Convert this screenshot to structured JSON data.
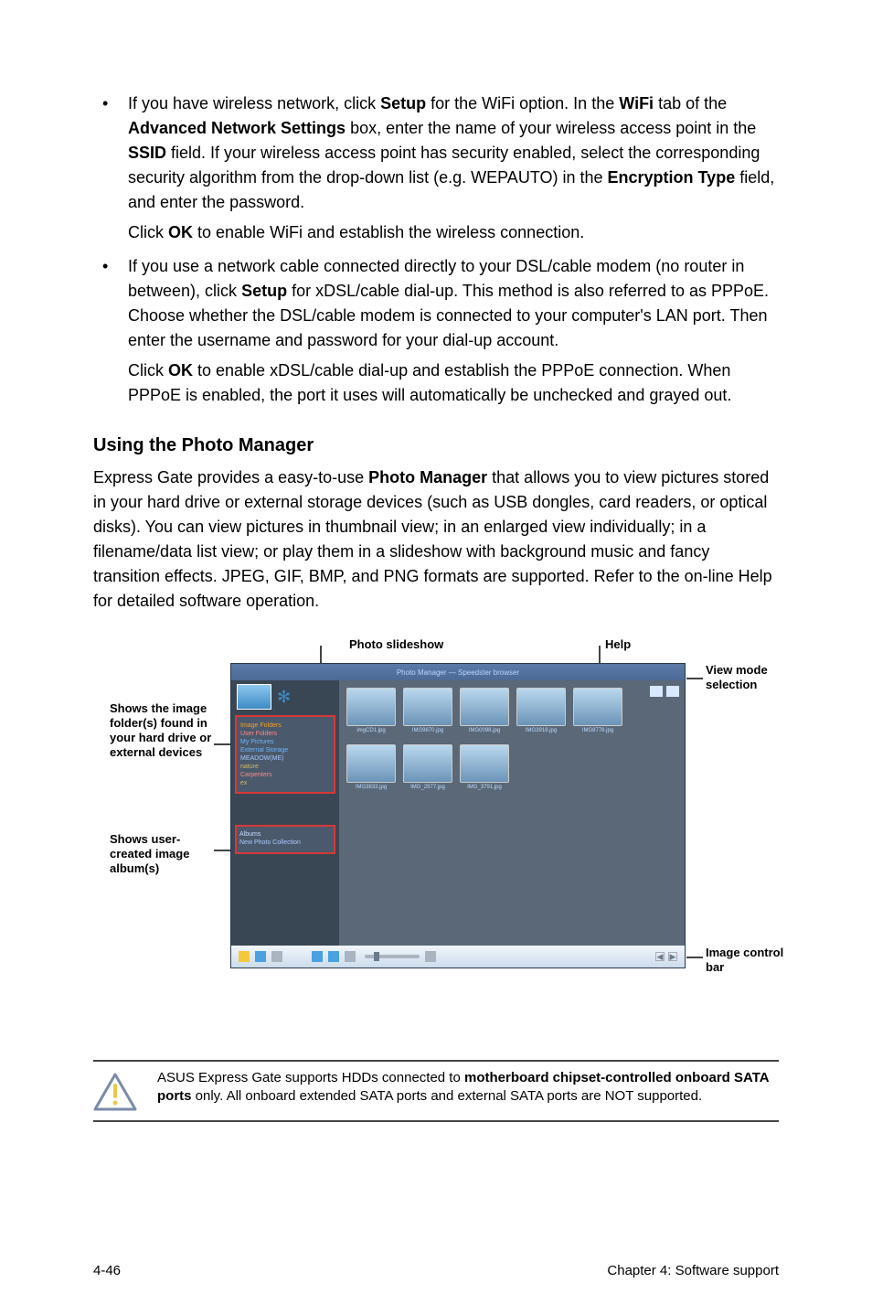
{
  "bullets": {
    "item1": {
      "text": "If you have wireless network, click <b>Setup</b> for the WiFi option. In the <b>WiFi</b> tab of the <b>Advanced Network Settings</b> box, enter the name of your wireless access point in the <b>SSID</b> field. If your wireless access point has security enabled, select the corresponding security algorithm from the drop-down list (e.g. WEPAUTO) in the <b>Encryption Type</b> field, and enter the password.",
      "sub": "Click <b>OK</b> to enable WiFi and establish the wireless connection."
    },
    "item2": {
      "text": "If you use a network cable connected directly to your DSL/cable modem (no router in between), click <b>Setup</b> for xDSL/cable dial-up. This method is also referred to as PPPoE. Choose whether the DSL/cable modem is connected to your computer's LAN port. Then enter the username and password for your dial-up account.",
      "sub": "Click <b>OK</b> to enable xDSL/cable dial-up and establish the PPPoE connection. When PPPoE is enabled, the port it uses will automatically be unchecked and grayed out."
    }
  },
  "section": {
    "head": "Using the Photo Manager",
    "body": "Express Gate  provides a easy-to-use <b>Photo Manager</b> that allows you to view pictures stored in your hard drive or external storage devices (such as USB dongles, card readers, or optical disks). You can view pictures in thumbnail view; in an enlarged view individually; in a filename/data list view; or play them in a slideshow with background music and fancy transition effects. JPEG, GIF, BMP, and PNG formats are supported. Refer to the on-line Help for detailed software operation."
  },
  "diagram": {
    "labels": {
      "photo_slideshow": "Photo slideshow",
      "help": "Help",
      "view_mode": "View mode selection",
      "shows_folders": "Shows the image folder(s) found in your hard drive or external devices",
      "shows_albums": "Shows user-created image album(s)",
      "image_ctrl": "Image control bar"
    },
    "app": {
      "title": "Photo Manager — Speedster browser",
      "sidebar": {
        "box1_items": [
          "Image Folders",
          "User Folders",
          "My Pictures",
          "External Storage",
          "MEADOW(ME)",
          "nature",
          "Carpenters",
          "ex"
        ],
        "album_label": "Albums",
        "album_item": "New Photo Collection"
      },
      "thumbs": [
        "imgCD1.jpg",
        "IMG9870.jpg",
        "IMG0098.jpg",
        "IMG3918.jpg",
        "IMG8778.jpg",
        "IMG3833.jpg",
        "IMG_2977.jpg",
        "IMG_3791.jpg"
      ]
    }
  },
  "warn": "ASUS Express Gate supports HDDs connected to <b>motherboard chipset-controlled onboard SATA ports</b> only. All onboard extended SATA ports and external SATA ports are NOT supported.",
  "footer": {
    "left": "4-46",
    "right": "Chapter 4: Software support"
  }
}
